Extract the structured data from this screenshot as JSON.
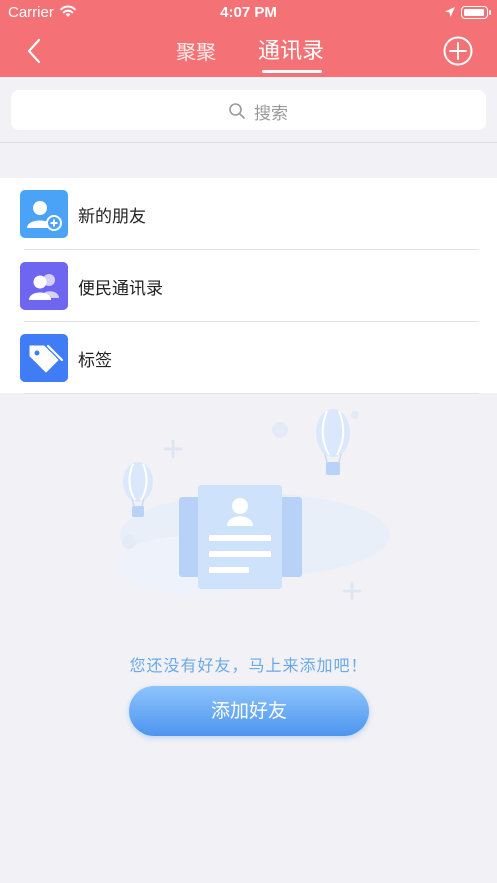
{
  "status_bar": {
    "carrier": "Carrier",
    "time": "4:07 PM"
  },
  "header": {
    "tabs": [
      "聚聚",
      "通讯录"
    ],
    "active_tab": "通讯录",
    "color": "#f47275"
  },
  "search": {
    "placeholder": "搜索"
  },
  "menu": [
    {
      "label": "新的朋友",
      "icon": "add-user-icon",
      "color": "#4aa3f7"
    },
    {
      "label": "便民通讯录",
      "icon": "contacts-group-icon",
      "color": "#6e66f0"
    },
    {
      "label": "标签",
      "icon": "tag-icon",
      "color": "#3f7cf6"
    }
  ],
  "empty": {
    "message": "您还没有好友，马上来添加吧！",
    "button": "添加好友"
  }
}
